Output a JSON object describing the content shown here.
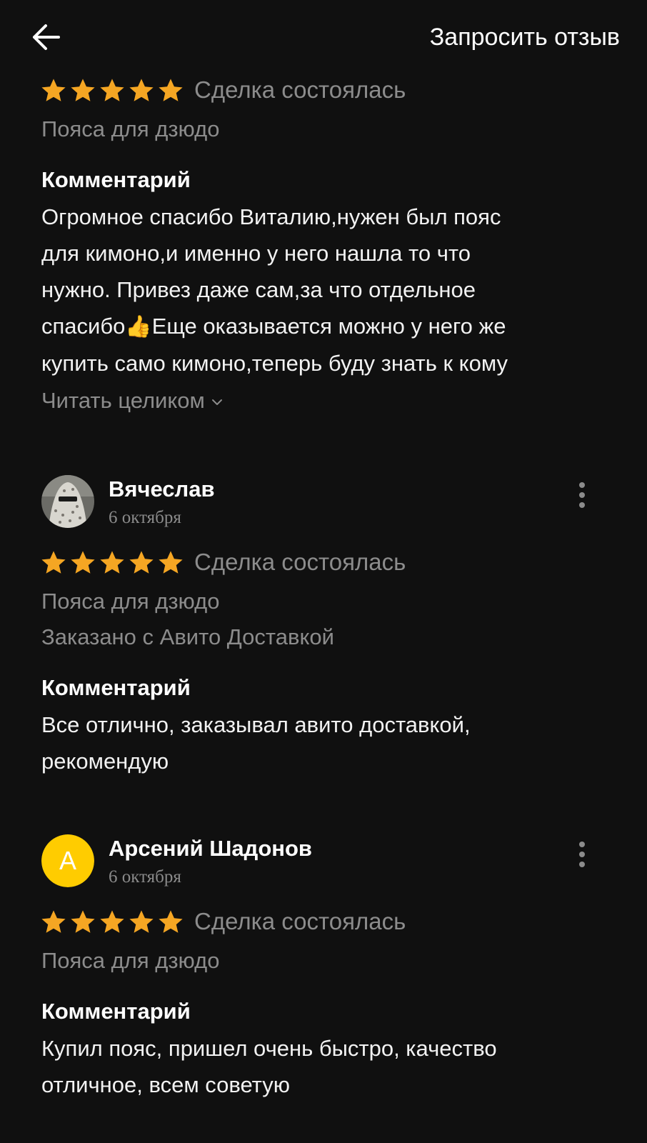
{
  "header": {
    "request_review_label": "Запросить отзыв"
  },
  "reviews": [
    {
      "rating": 5,
      "deal_status": "Сделка состоялась",
      "item": "Пояса для дзюдо",
      "comment_title": "Комментарий",
      "comment_lines": [
        "Огромное спасибо Виталию,нужен был пояс",
        "для кимоно,и именно у него нашла то что",
        "нужно. Привез даже сам,за что отдельное",
        "спасибо",
        "Еще оказывается можно у него же",
        "купить само кимоно,теперь буду знать к кому"
      ],
      "thumb_emoji": "👍",
      "read_more": "Читать целиком"
    },
    {
      "author": "Вячеслав",
      "date": "6 октября",
      "avatar": "photo-avatar",
      "rating": 5,
      "deal_status": "Сделка состоялась",
      "item": "Пояса для дзюдо",
      "delivery": "Заказано с Авито Доставкой",
      "comment_title": "Комментарий",
      "comment_lines": [
        "Все отлично, заказывал авито доставкой,",
        "рекомендую"
      ]
    },
    {
      "author": "Арсений Шадонов",
      "date": "6 октября",
      "avatar_letter": "А",
      "rating": 5,
      "deal_status": "Сделка состоялась",
      "item": "Пояса для дзюдо",
      "comment_title": "Комментарий",
      "comment_lines": [
        "Купил пояс, пришел очень быстро, качество",
        "отличное, всем советую"
      ]
    }
  ],
  "colors": {
    "background": "#101010",
    "star": "#f5a623",
    "secondary_text": "#8c8c8c",
    "avatar_yellow": "#ffcc00"
  },
  "icons": {
    "back": "arrow-left-icon",
    "more": "kebab-menu-icon",
    "star": "star-icon",
    "chevron": "chevron-down-icon"
  }
}
